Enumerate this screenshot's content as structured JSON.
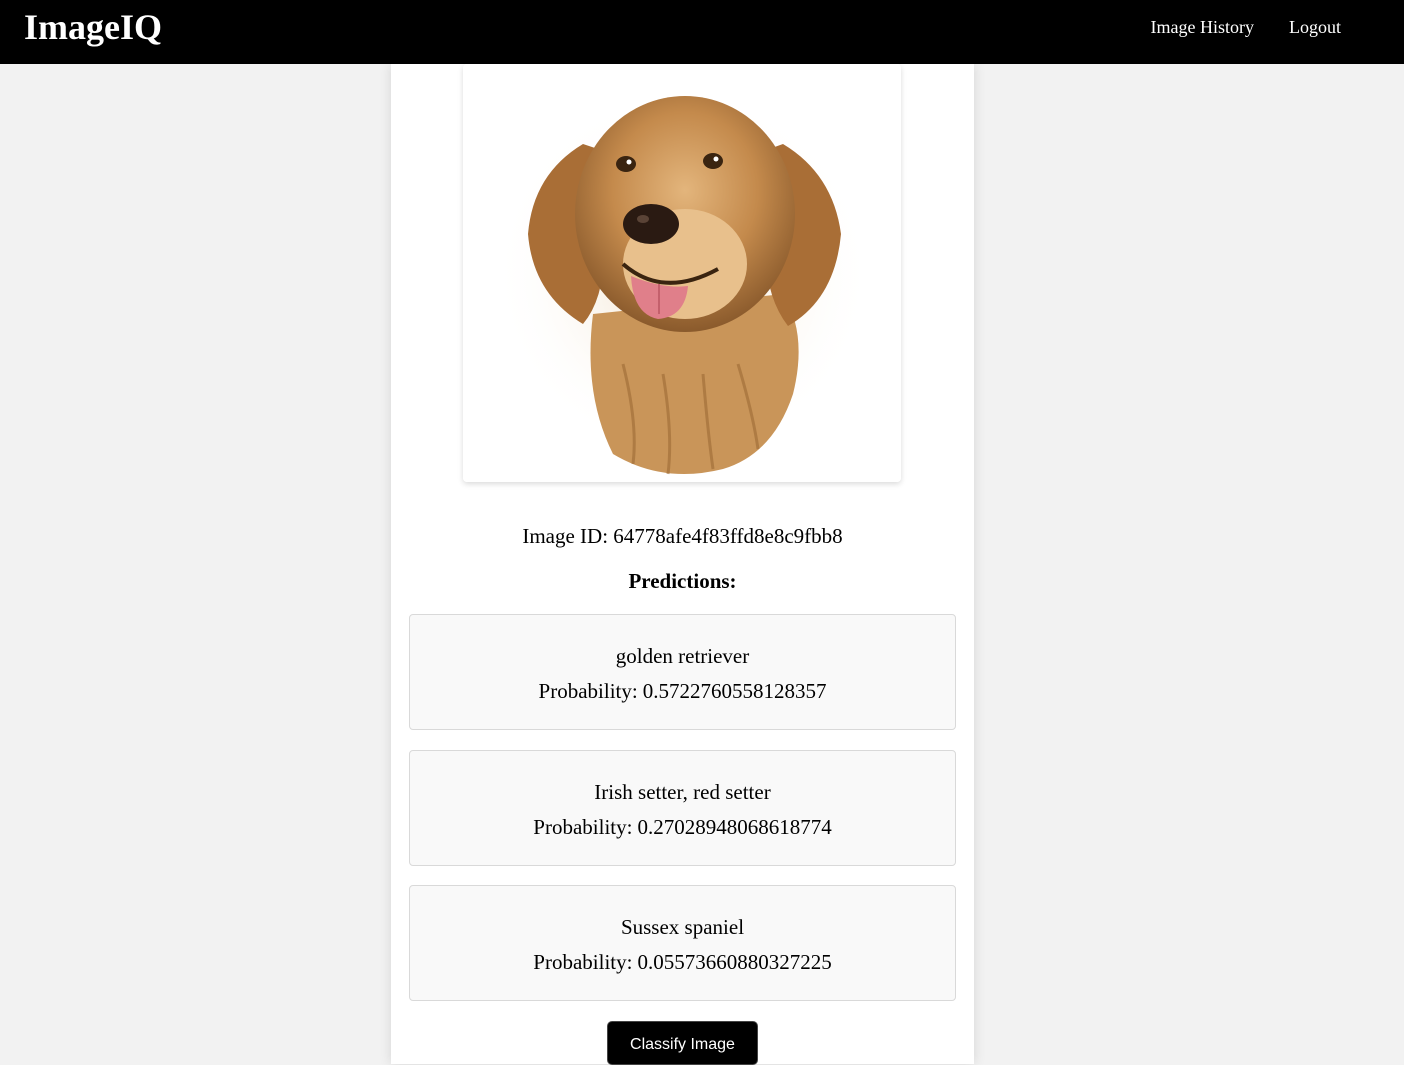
{
  "navbar": {
    "brand": "ImageIQ",
    "links": [
      {
        "label": "Image History"
      },
      {
        "label": "Logout"
      }
    ]
  },
  "image": {
    "id_label": "Image ID:",
    "id_value": "64778afe4f83ffd8e8c9fbb8",
    "alt": "golden retriever illustration"
  },
  "predictions": {
    "heading": "Predictions:",
    "prob_label": "Probability:",
    "items": [
      {
        "label": "golden retriever",
        "probability": "0.5722760558128357"
      },
      {
        "label": "Irish setter, red setter",
        "probability": "0.27028948068618774"
      },
      {
        "label": "Sussex spaniel",
        "probability": "0.05573660880327225"
      }
    ]
  },
  "actions": {
    "classify_label": "Classify Image"
  },
  "colors": {
    "navbar_bg": "#000000",
    "page_bg": "#f2f2f2",
    "card_bg": "#ffffff",
    "prediction_bg": "#f9f9f9",
    "button_bg": "#000000"
  }
}
